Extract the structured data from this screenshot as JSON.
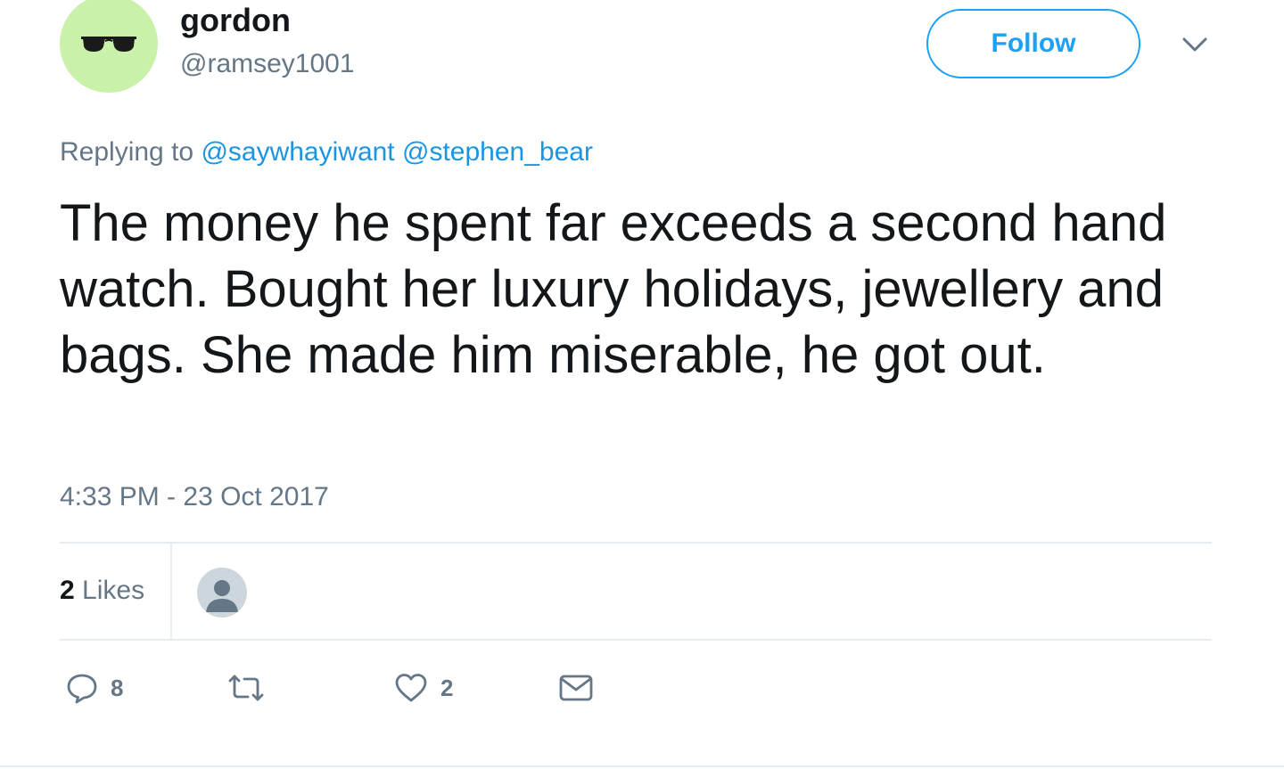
{
  "author": {
    "display_name": "gordon",
    "handle": "@ramsey1001",
    "avatar_icon": "sunglasses-icon",
    "avatar_bg": "#c9f1a9"
  },
  "header": {
    "follow_label": "Follow",
    "caret_icon": "chevron-down-icon"
  },
  "reply_context": {
    "prefix": "Replying to",
    "mentions": [
      "@saywhayiwant",
      "@stephen_bear"
    ]
  },
  "tweet": {
    "text": "The money he spent far exceeds a second hand watch. Bought her luxury holidays, jewellery and bags. She made him miserable, he got out.",
    "timestamp": "4:33 PM - 23 Oct 2017"
  },
  "stats": {
    "likes_count": "2",
    "likes_label": "Likes"
  },
  "actions": {
    "reply_count": "8",
    "retweet_count": "",
    "like_count": "2"
  },
  "colors": {
    "accent": "#1da1f2",
    "mention": "#1b95e0",
    "secondary_text": "#657786",
    "divider": "#e6ecf0"
  }
}
